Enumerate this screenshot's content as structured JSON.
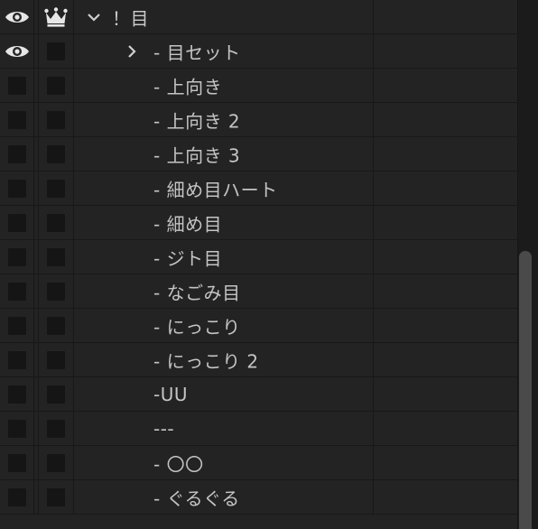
{
  "layers": {
    "group": {
      "label": "！目",
      "expanded": true,
      "visible": true,
      "crown": true
    },
    "items": [
      {
        "label": "- 目セット",
        "visible": true,
        "collapsed_group": true
      },
      {
        "label": "- 上向き",
        "visible": false
      },
      {
        "label": "- 上向き 2",
        "visible": false
      },
      {
        "label": "- 上向き 3",
        "visible": false
      },
      {
        "label": "- 細め目ハート",
        "visible": false
      },
      {
        "label": "- 細め目",
        "visible": false
      },
      {
        "label": "- ジト目",
        "visible": false
      },
      {
        "label": "- なごみ目",
        "visible": false
      },
      {
        "label": "- にっこり",
        "visible": false
      },
      {
        "label": "- にっこり 2",
        "visible": false
      },
      {
        "label": "-UU",
        "visible": false
      },
      {
        "label": "---",
        "visible": false
      },
      {
        "label": "- 〇〇",
        "visible": false
      },
      {
        "label": "- ぐるぐる",
        "visible": false
      }
    ]
  },
  "icons": {
    "eye": "eye-icon",
    "crown": "crown-icon",
    "expand": "chevron-down-icon",
    "collapse": "chevron-right-icon"
  },
  "colors": {
    "panel_bg": "#232323",
    "text": "#c4c4c4",
    "box": "#151515",
    "thumb": "#4a4a4a"
  }
}
